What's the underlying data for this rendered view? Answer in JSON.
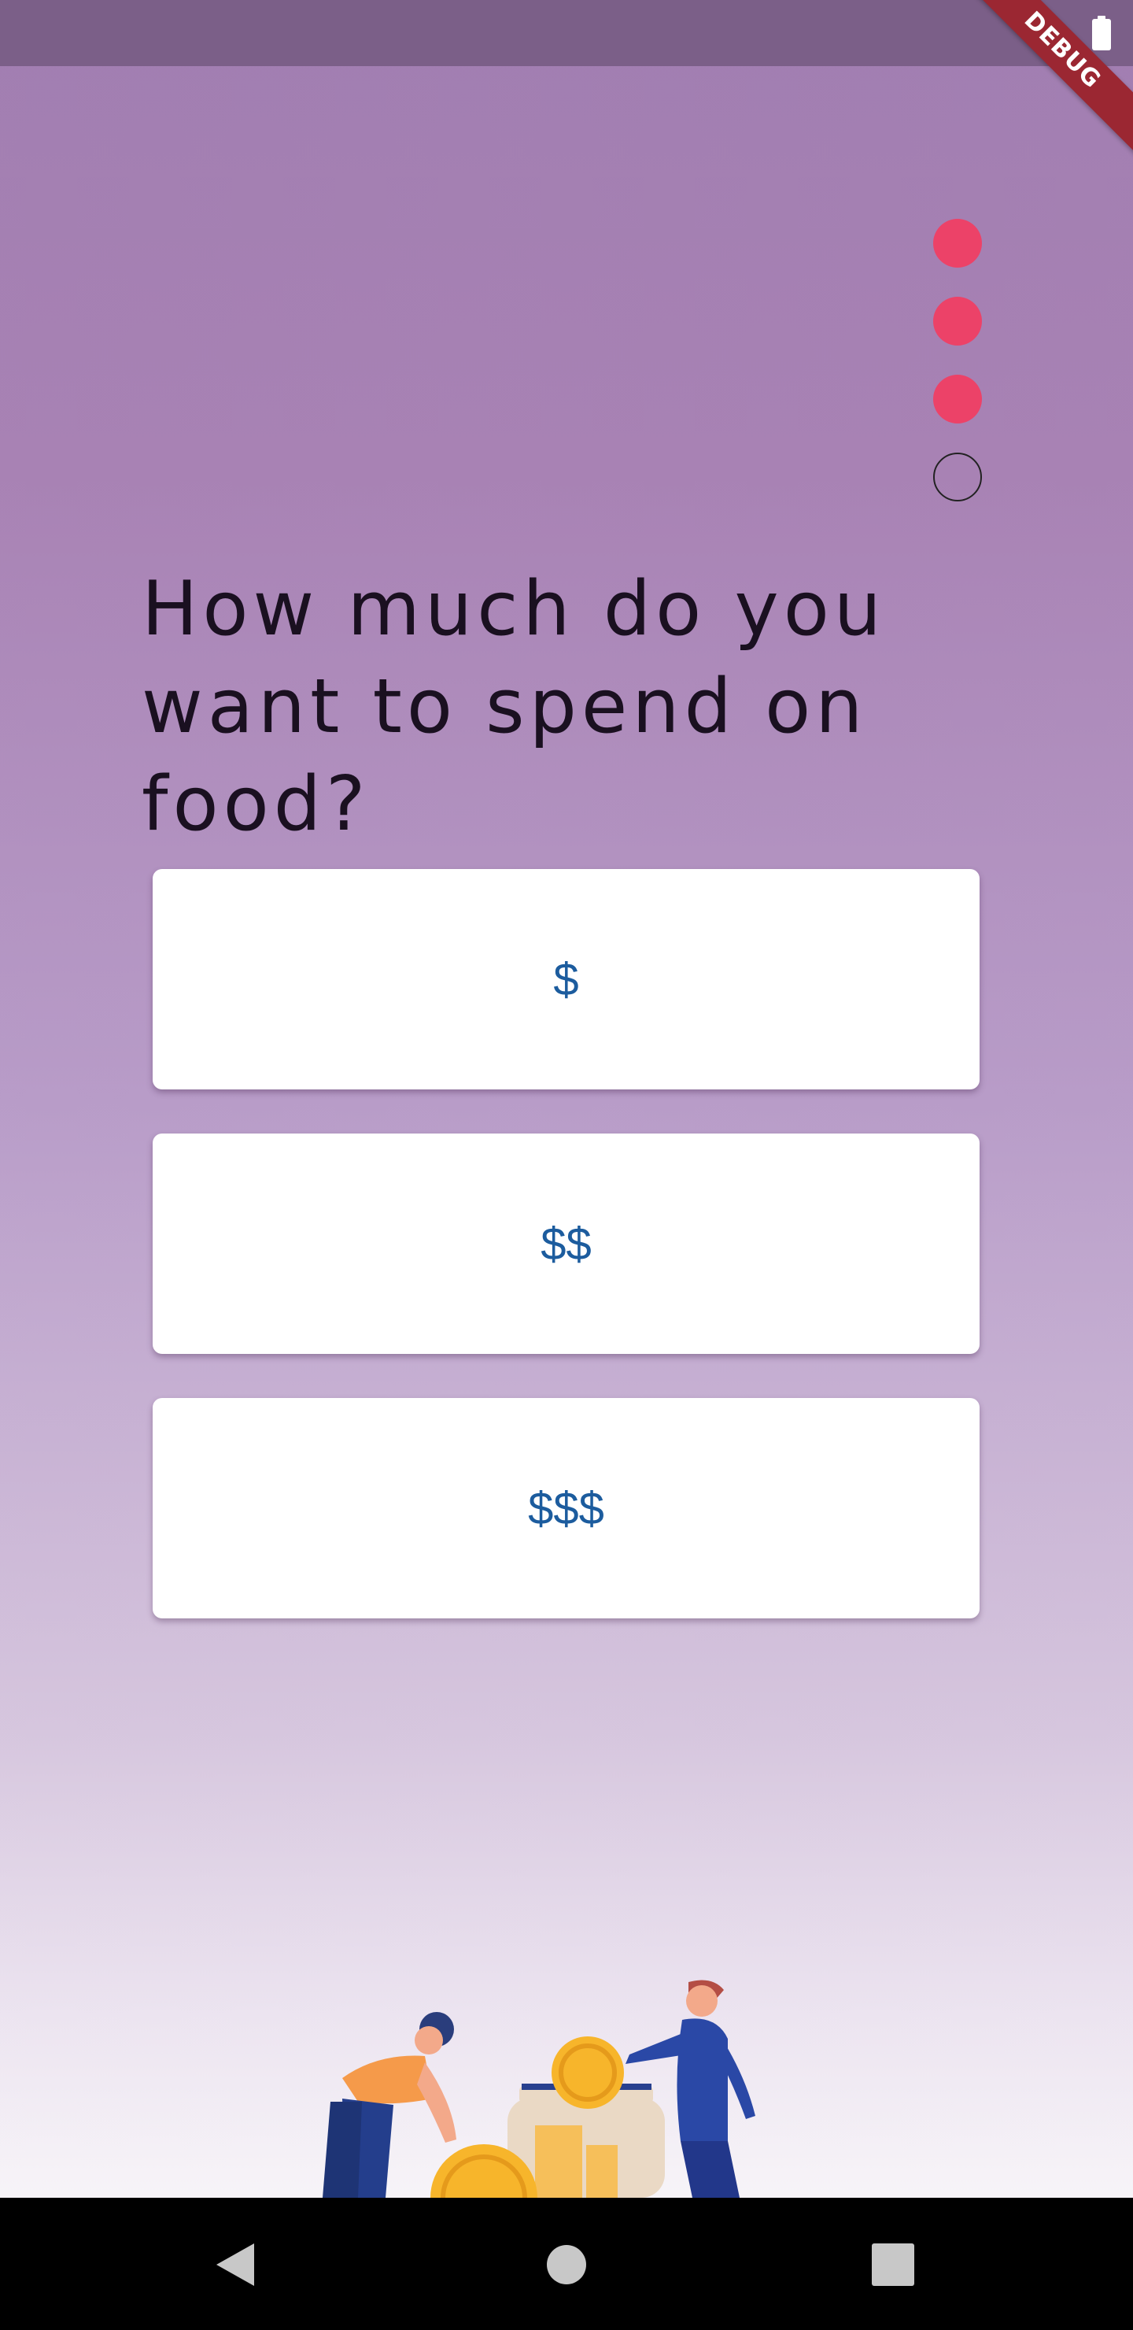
{
  "status_bar": {
    "icons": [
      "battery-icon"
    ]
  },
  "debug_banner": {
    "label": "DEBUG"
  },
  "progress": {
    "total_steps": 4,
    "completed_steps": 3,
    "filled_color": "#ec4268"
  },
  "question": {
    "text": "How much do you want to spend on food?"
  },
  "options": [
    {
      "label": "$"
    },
    {
      "label": "$$"
    },
    {
      "label": "$$$"
    }
  ],
  "colors": {
    "accent": "#ec4268",
    "option_text": "#1c5c9e",
    "background_top": "#a17eb1"
  },
  "navigation": {
    "icons": [
      "back-icon",
      "home-icon",
      "recents-icon"
    ]
  }
}
